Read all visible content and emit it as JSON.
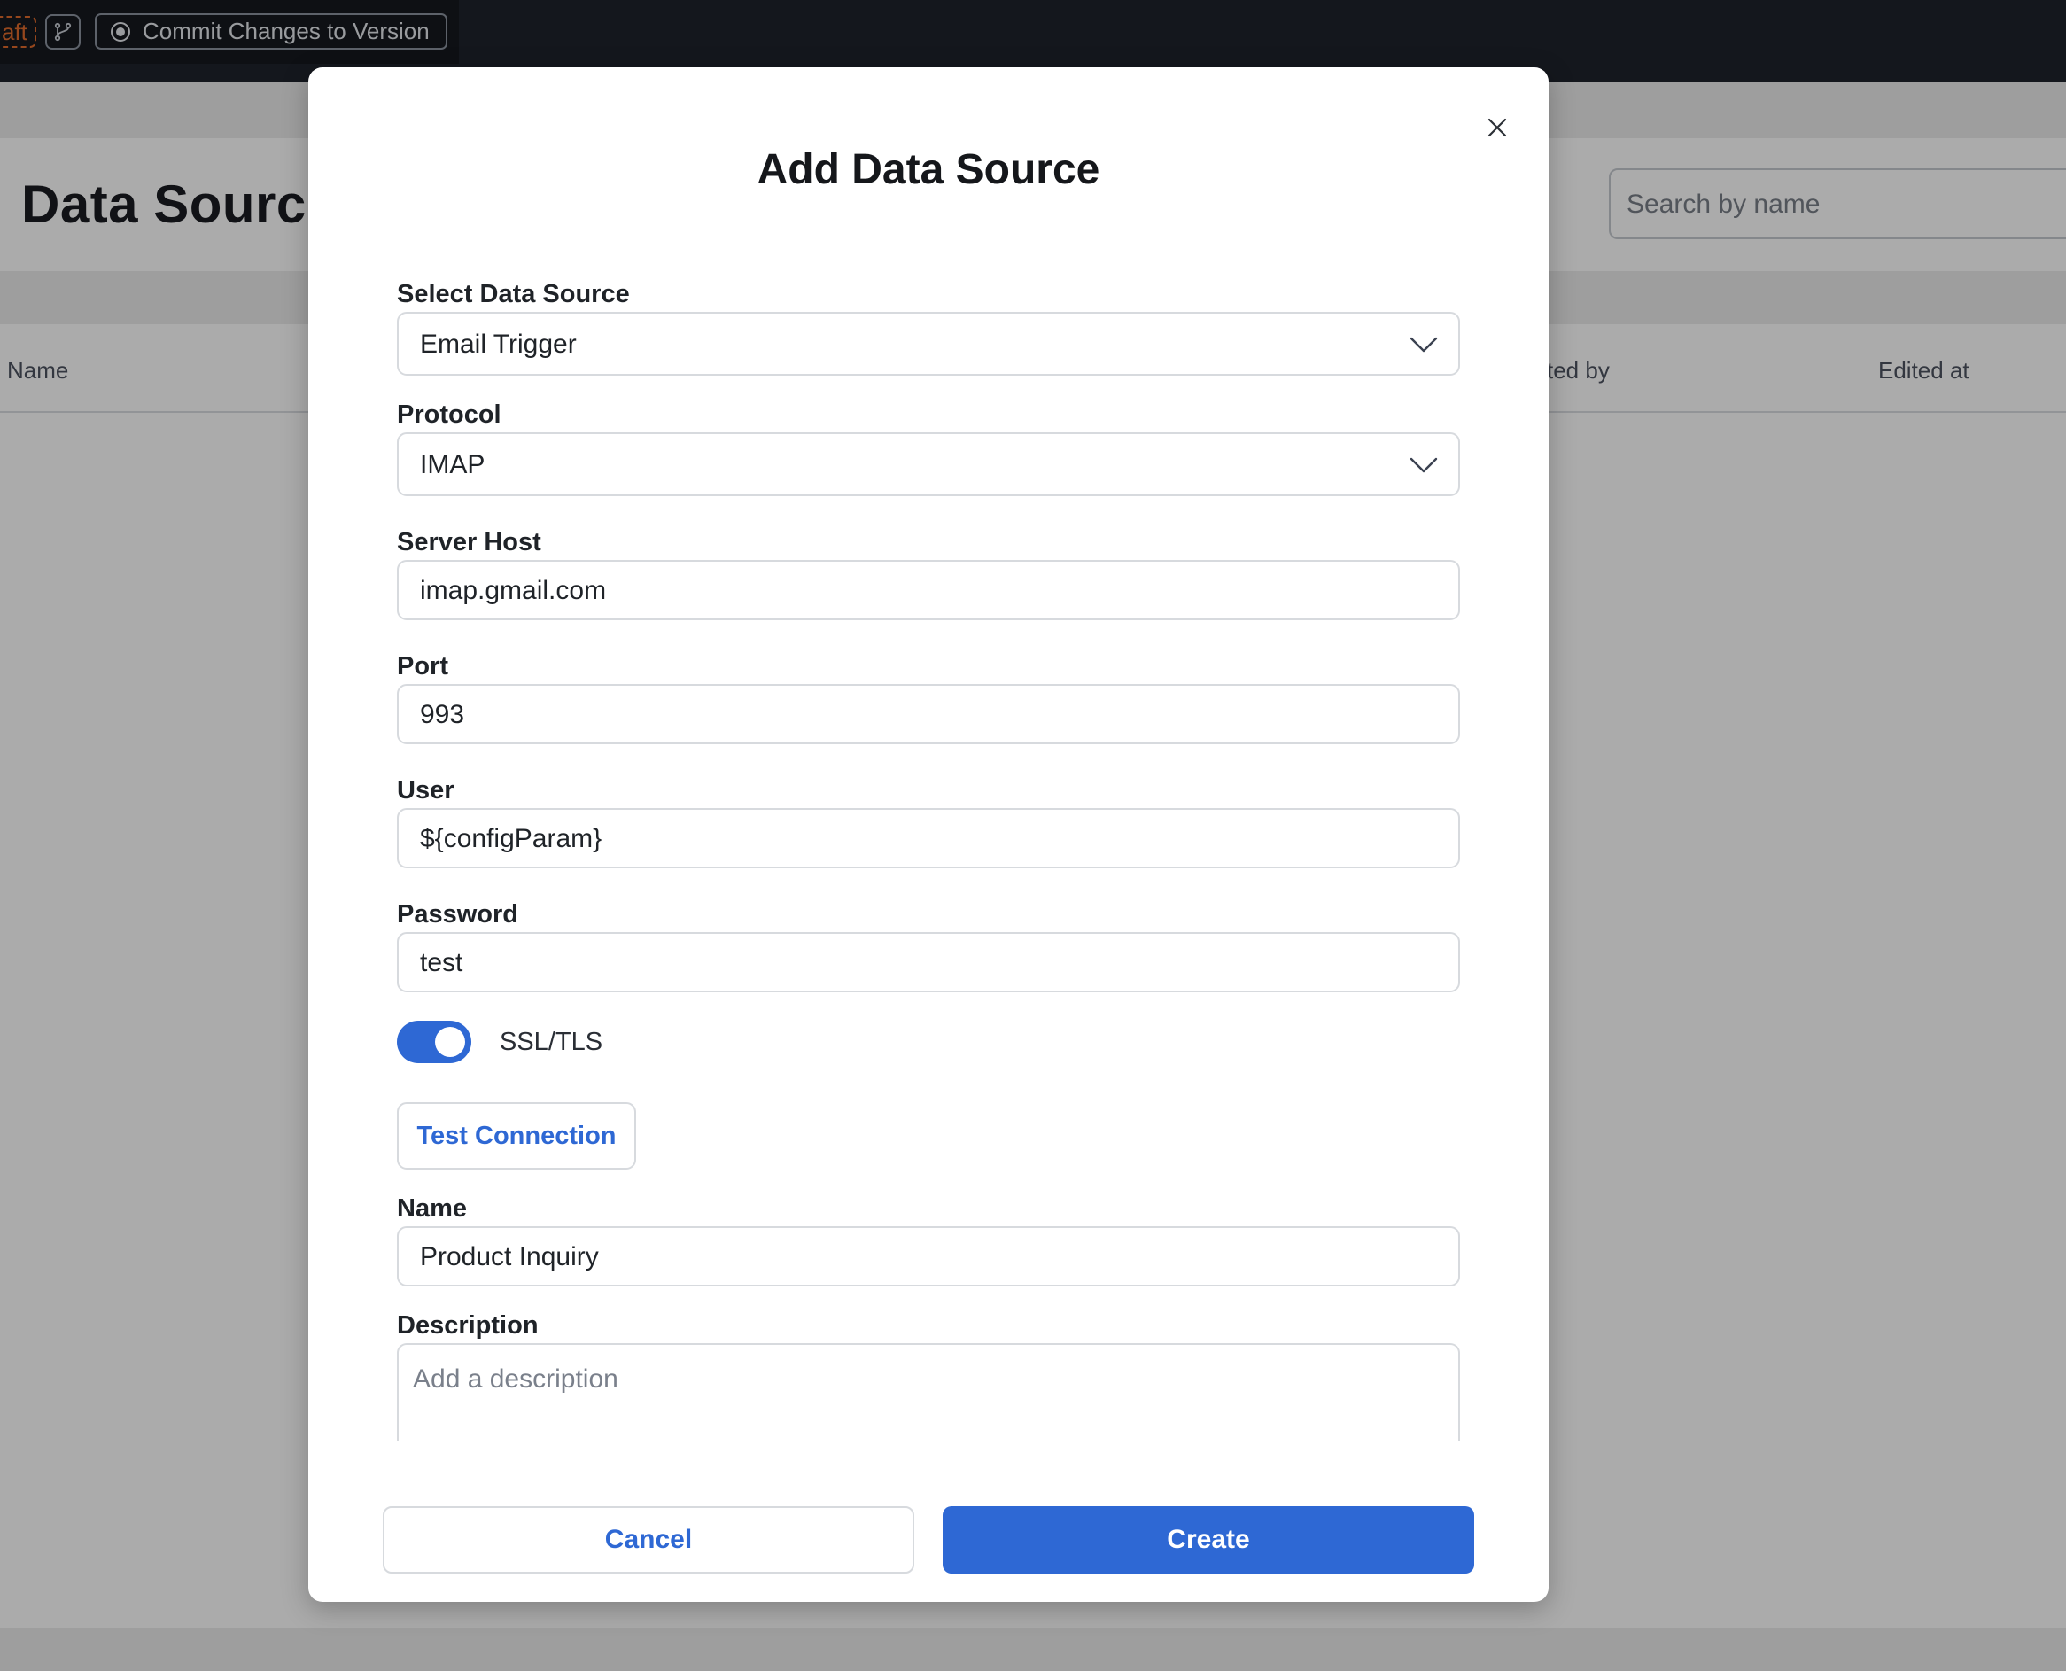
{
  "topbar": {
    "draft_badge": "aft",
    "commit_label": "Commit Changes to Version"
  },
  "page": {
    "title": "Data Source",
    "search_placeholder": "Search by name",
    "columns": [
      "Name",
      "ted by",
      "Edited at"
    ]
  },
  "modal": {
    "title": "Add Data Source",
    "fields": {
      "data_source": {
        "label": "Select Data Source",
        "value": "Email Trigger"
      },
      "protocol": {
        "label": "Protocol",
        "value": "IMAP"
      },
      "server_host": {
        "label": "Server Host",
        "value": "imap.gmail.com"
      },
      "port": {
        "label": "Port",
        "value": "993"
      },
      "user": {
        "label": "User",
        "value": "${configParam}"
      },
      "password": {
        "label": "Password",
        "value": "test"
      },
      "ssl": {
        "label": "SSL/TLS",
        "enabled": true
      },
      "name": {
        "label": "Name",
        "value": "Product Inquiry"
      },
      "description": {
        "label": "Description",
        "placeholder": "Add a description"
      }
    },
    "test_connection_label": "Test Connection",
    "cancel_label": "Cancel",
    "create_label": "Create"
  },
  "colors": {
    "accent": "#2e68d4",
    "topbar": "#1f232c",
    "draft": "#e06b2c"
  },
  "icons": {
    "close": "close-icon",
    "branch": "git-branch-icon",
    "commit": "commit-icon",
    "dropdown": "chevron-down-icon"
  }
}
